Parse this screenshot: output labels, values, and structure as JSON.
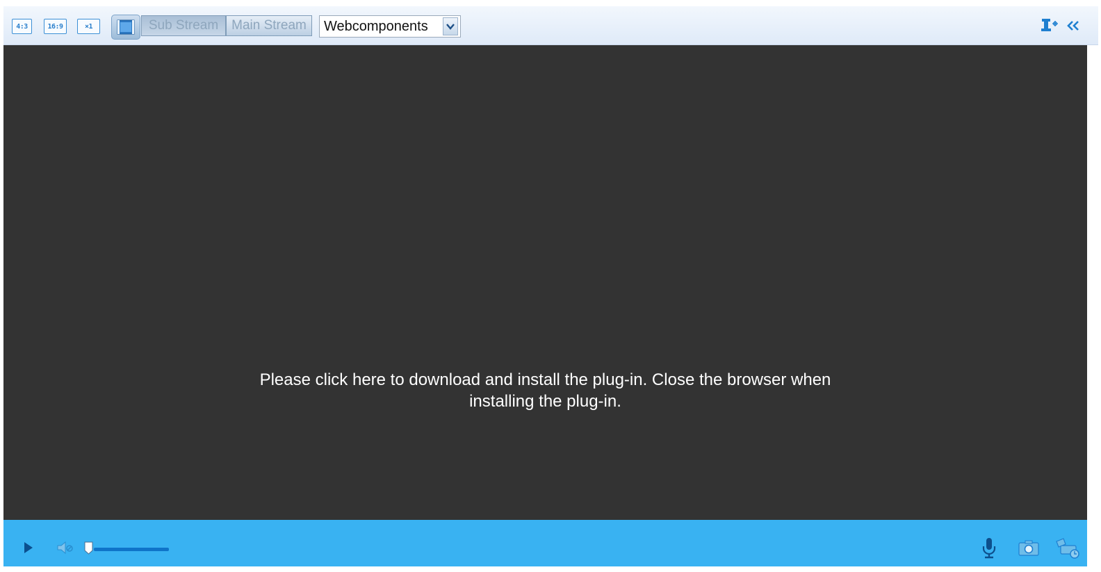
{
  "toolbar": {
    "ratio_buttons": [
      "4:3",
      "16:9",
      "×1"
    ],
    "fill_button_icon": "fill-window-icon",
    "streams": {
      "sub_label": "Sub Stream",
      "main_label": "Main Stream",
      "active": "sub"
    },
    "plugin_select": {
      "value": "Webcomponents",
      "icon": "chevron-down-icon"
    },
    "right_icons": [
      "ptz-control-icon",
      "collapse-double-chevron-icon"
    ]
  },
  "video": {
    "message": "Please click here to download and install the plug-in. Close the browser when installing the plug-in."
  },
  "bottombar": {
    "volume_level": 0.0,
    "left_icons": [
      "play-icon",
      "speaker-icon"
    ],
    "right_icons": [
      "microphone-icon",
      "camera-capture-icon",
      "record-icon"
    ]
  },
  "colors": {
    "toolbar_bg": "#dfeaf8",
    "video_bg": "#333333",
    "bottombar_bg": "#39b2f2",
    "accent": "#1e7fd0"
  }
}
